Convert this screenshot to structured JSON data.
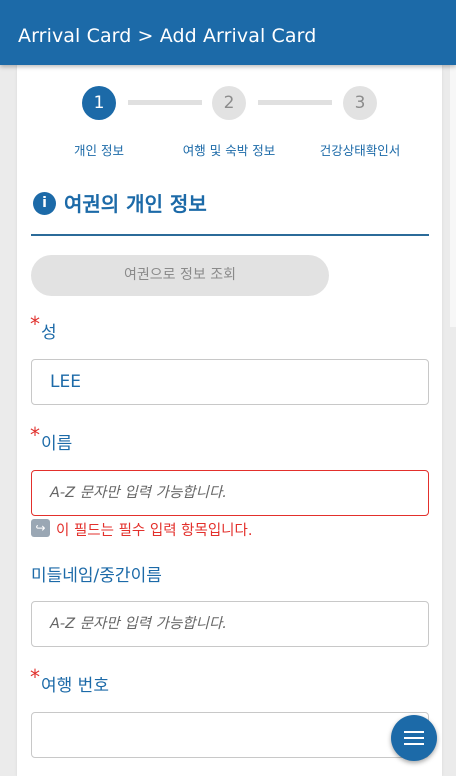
{
  "header": {
    "title": "Arrival Card > Add Arrival Card"
  },
  "stepper": {
    "steps": [
      {
        "number": "1",
        "label": "개인 정보",
        "active": true
      },
      {
        "number": "2",
        "label": "여행 및 숙박 정보",
        "active": false
      },
      {
        "number": "3",
        "label": "건강상태확인서",
        "active": false
      }
    ]
  },
  "section": {
    "title": "여권의 개인 정보",
    "icon": "info-icon"
  },
  "lookup_button": {
    "label": "여권으로 정보 조회"
  },
  "fields": {
    "surname": {
      "label": "성",
      "required": true,
      "value": "LEE"
    },
    "given_name": {
      "label": "이름",
      "required": true,
      "placeholder": "A-Z 문자만 입력 가능합니다.",
      "error": "이 필드는 필수 입력 항목입니다."
    },
    "middle_name": {
      "label": "미들네임/중간이름",
      "required": false,
      "placeholder": "A-Z 문자만 입력 가능합니다."
    },
    "trip_number": {
      "label": "여행 번호",
      "required": true,
      "value": ""
    }
  },
  "colors": {
    "primary": "#1c6aa8",
    "error": "#e3302c",
    "disabled": "#e2e2e2"
  },
  "fab": {
    "icon": "menu-icon"
  }
}
